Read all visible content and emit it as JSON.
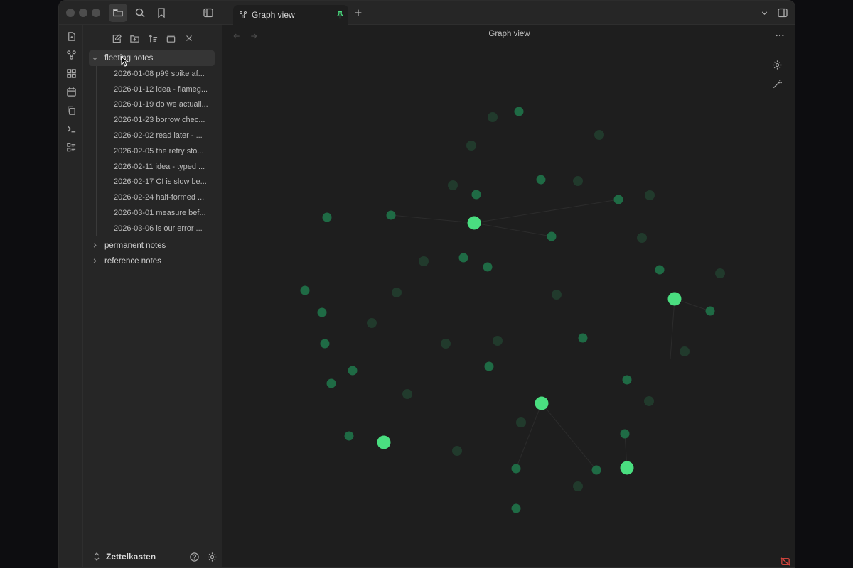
{
  "tab": {
    "label": "Graph view"
  },
  "pane": {
    "title": "Graph view"
  },
  "explorer": {
    "folders": [
      {
        "label": "fleeting notes",
        "expanded": true,
        "files": [
          "2026-01-08 p99 spike af...",
          "2026-01-12 idea - flameg...",
          "2026-01-19 do we actuall...",
          "2026-01-23 borrow chec...",
          "2026-02-02 read later - ...",
          "2026-02-05 the retry sto...",
          "2026-02-11 idea - typed ...",
          "2026-02-17 CI is slow be...",
          "2026-02-24 half-formed ...",
          "2026-03-01 measure bef...",
          "2026-03-06 is our error ..."
        ]
      },
      {
        "label": "permanent notes",
        "expanded": false
      },
      {
        "label": "reference notes",
        "expanded": false
      }
    ]
  },
  "vault": {
    "name": "Zettelkasten"
  },
  "colors": {
    "accent": "#4ade80",
    "node_dim": "#1f6b45",
    "node_faint": "#213a2c"
  },
  "icons": {
    "titlebar": [
      "files-icon",
      "search-icon",
      "bookmark-icon",
      "sidebar-toggle-icon",
      "pin-icon",
      "plus-icon",
      "chevron-down-icon",
      "right-sidebar-icon"
    ],
    "ribbon": [
      "new-note-icon",
      "graph-icon",
      "canvas-icon",
      "calendar-icon",
      "copy-icon",
      "terminal-icon",
      "list-icon"
    ],
    "explorer_toolbar": [
      "new-note-icon",
      "new-folder-icon",
      "sort-icon",
      "collapse-icon",
      "close-icon"
    ]
  }
}
